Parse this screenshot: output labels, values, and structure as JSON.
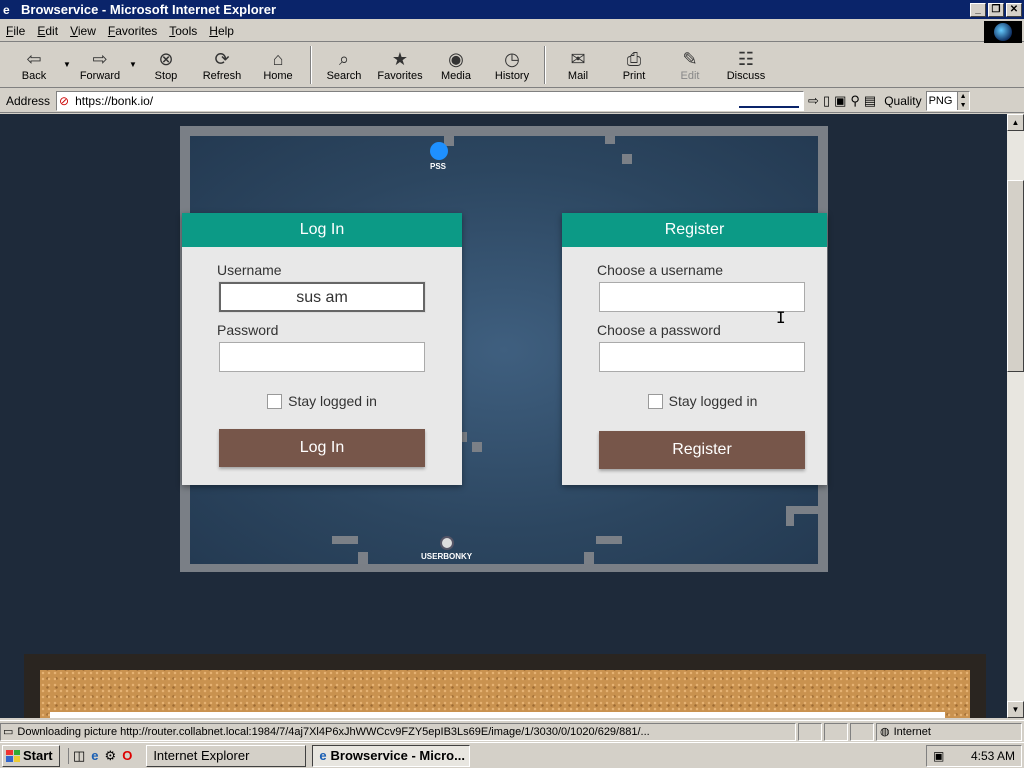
{
  "window": {
    "title": "Browservice - Microsoft Internet Explorer"
  },
  "menu": [
    "File",
    "Edit",
    "View",
    "Favorites",
    "Tools",
    "Help"
  ],
  "toolbar": {
    "back": "Back",
    "forward": "Forward",
    "stop": "Stop",
    "refresh": "Refresh",
    "home": "Home",
    "search": "Search",
    "favorites": "Favorites",
    "media": "Media",
    "history": "History",
    "mail": "Mail",
    "print": "Print",
    "edit": "Edit",
    "discuss": "Discuss"
  },
  "address": {
    "label": "Address",
    "url": "https://bonk.io/",
    "quality_label": "Quality",
    "quality_value": "PNG"
  },
  "game": {
    "players": [
      {
        "name": "PSS",
        "color": "#1e90ff"
      },
      {
        "name": "USERBONKY",
        "color": "#dddddd"
      }
    ]
  },
  "login": {
    "title": "Log In",
    "username_label": "Username",
    "username_value": "sus am",
    "password_label": "Password",
    "password_value": "",
    "stay_label": "Stay logged in",
    "button": "Log In"
  },
  "register": {
    "title": "Register",
    "username_label": "Choose a username",
    "username_value": "",
    "password_label": "Choose a password",
    "password_value": "",
    "stay_label": "Stay logged in",
    "button": "Register"
  },
  "status": {
    "text": "Downloading picture http://router.collabnet.local:1984/7/4aj7Xl4P6xJhWWCcv9FZY5epIB3Ls69E/image/1/3030/0/1020/629/881/...",
    "zone": "Internet"
  },
  "taskbar": {
    "start": "Start",
    "tasks": [
      "Internet Explorer",
      "Browservice - Micro..."
    ],
    "clock": "4:53 AM"
  },
  "colors": {
    "panel_header": "#0c9a86",
    "button": "#77564a",
    "titlebar": "#0a246a"
  }
}
